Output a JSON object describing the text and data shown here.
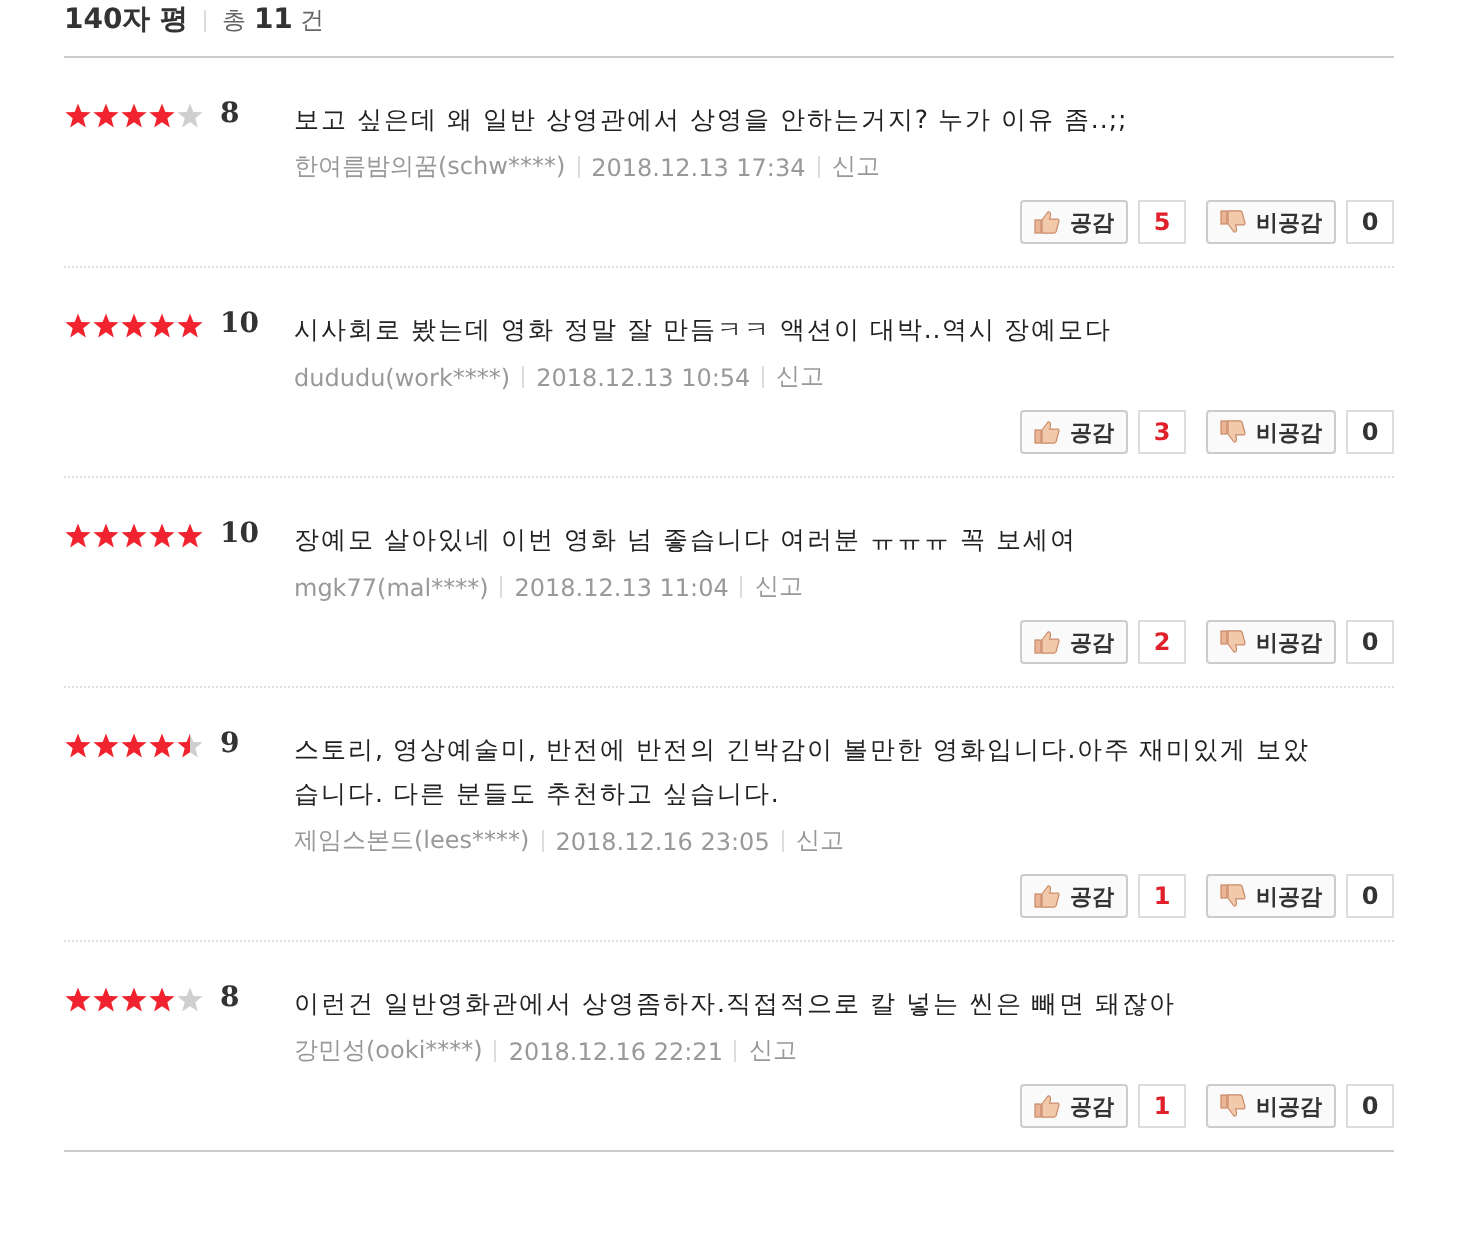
{
  "header": {
    "title": "140자 평",
    "total_prefix": "총",
    "total_count": "11",
    "total_suffix": "건"
  },
  "reviews": [
    {
      "stars": 4,
      "score": "8",
      "text": "보고 싶은데 왜 일반 상영관에서 상영을 안하는거지? 누가 이유 좀..;;",
      "author": "한여름밤의꿈(schw****)",
      "date": "2018.12.13 17:34",
      "report": "신고",
      "like_label": "공감",
      "likes": "5",
      "dislike_label": "비공감",
      "dislikes": "0"
    },
    {
      "stars": 5,
      "score": "10",
      "text": "시사회로 봤는데 영화 정말 잘 만듬ㅋㅋ 액션이 대박..역시 장예모다",
      "author": "dududu(work****)",
      "date": "2018.12.13 10:54",
      "report": "신고",
      "like_label": "공감",
      "likes": "3",
      "dislike_label": "비공감",
      "dislikes": "0"
    },
    {
      "stars": 5,
      "score": "10",
      "text": "장예모 살아있네 이번 영화 넘 좋습니다 여러분 ㅠㅠㅠ 꼭 보세여",
      "author": "mgk77(mal****)",
      "date": "2018.12.13 11:04",
      "report": "신고",
      "like_label": "공감",
      "likes": "2",
      "dislike_label": "비공감",
      "dislikes": "0"
    },
    {
      "stars": 4.5,
      "score": "9",
      "text": "스토리, 영상예술미, 반전에 반전의 긴박감이 볼만한 영화입니다.아주 재미있게 보았습니다. 다른 분들도 추천하고 싶습니다.",
      "author": "제임스본드(lees****)",
      "date": "2018.12.16 23:05",
      "report": "신고",
      "like_label": "공감",
      "likes": "1",
      "dislike_label": "비공감",
      "dislikes": "0"
    },
    {
      "stars": 4,
      "score": "8",
      "text": "이런건 일반영화관에서 상영좀하자.직접적으로 칼 넣는 씬은 빼면 돼잖아",
      "author": "강민성(ooki****)",
      "date": "2018.12.16 22:21",
      "report": "신고",
      "like_label": "공감",
      "likes": "1",
      "dislike_label": "비공감",
      "dislikes": "0"
    }
  ]
}
